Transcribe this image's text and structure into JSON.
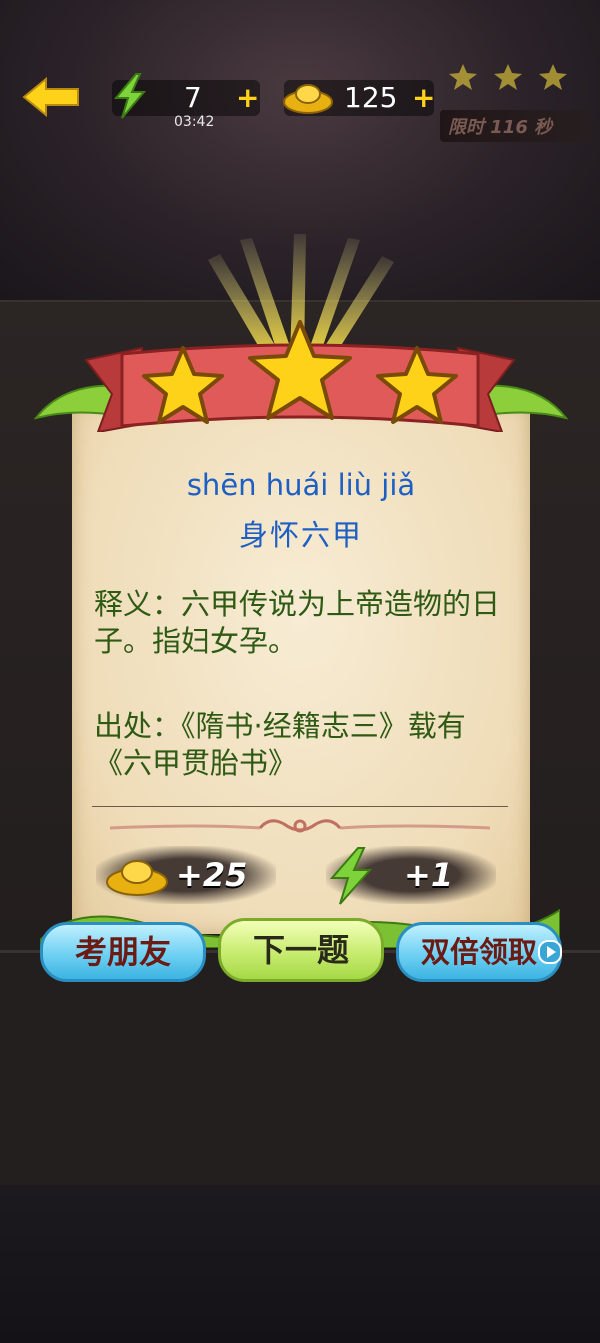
{
  "topbar": {
    "energy_value": "7",
    "energy_timer": "03:42",
    "gold_value": "125",
    "plus_symbol": "+",
    "limit_text": "限时 116 秒"
  },
  "card": {
    "pinyin": "shēn huái liù jiǎ",
    "idiom": "身怀六甲",
    "meaning": "释义：六甲传说为上帝造物的日子。指妇女孕。",
    "source": "出处：《隋书·经籍志三》载有《六甲贯胎书》",
    "stars_earned": 3,
    "reward_gold": "+25",
    "reward_energy": "+1"
  },
  "buttons": {
    "quiz_friends": "考朋友",
    "next_question": "下一题",
    "double_claim": "双倍领取"
  },
  "colors": {
    "pinyin": "#1e5fc4",
    "body_text": "#2e5a14",
    "gold": "#ffd21a"
  },
  "icons": {
    "back": "back-arrow-icon",
    "energy": "lightning-icon",
    "gold": "gold-ingot-icon",
    "star": "star-icon",
    "play": "play-icon"
  }
}
